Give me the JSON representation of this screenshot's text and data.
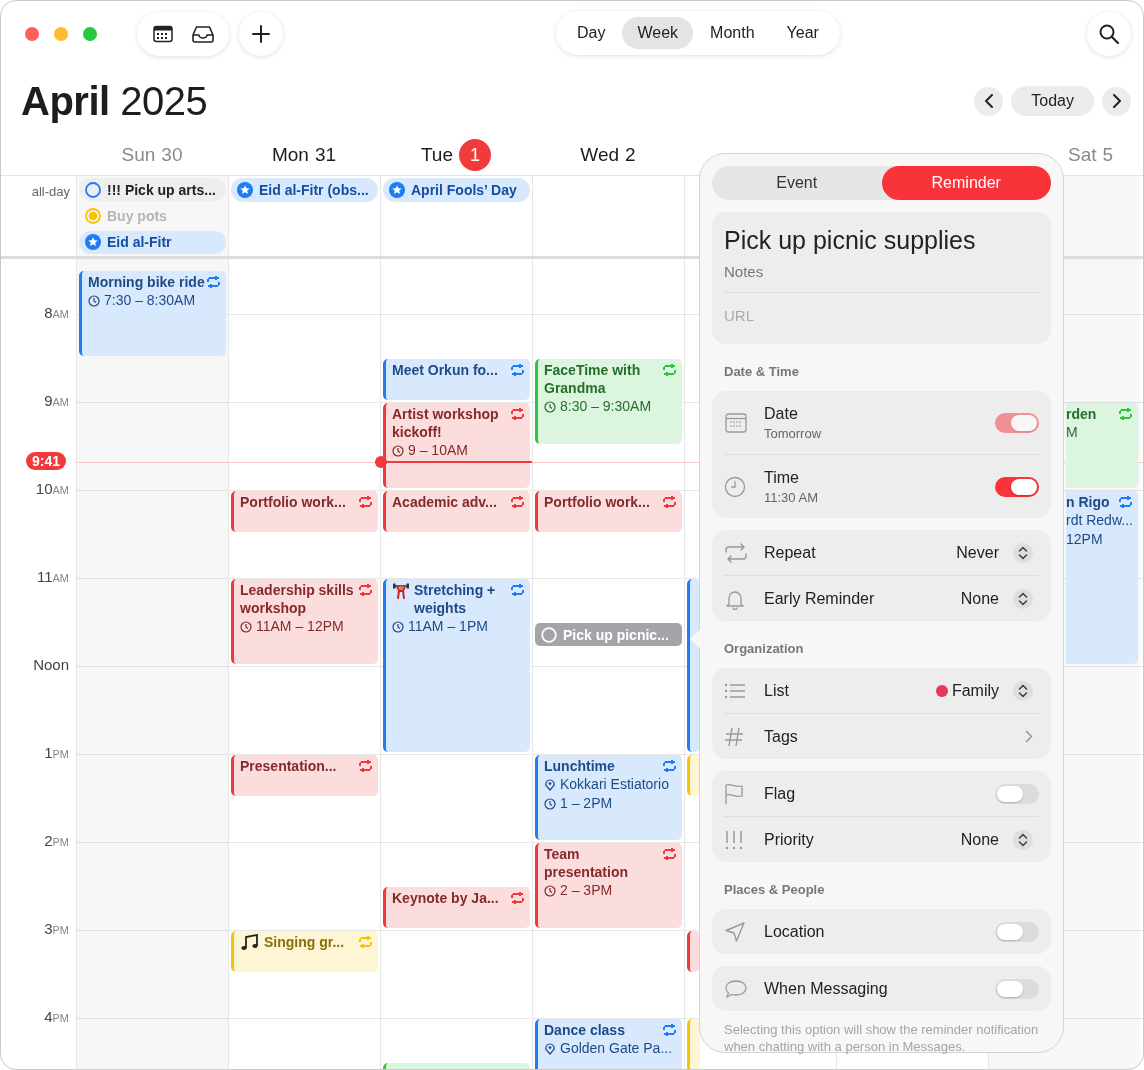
{
  "toolbar": {
    "views": [
      {
        "label": "Day",
        "selected": false
      },
      {
        "label": "Week",
        "selected": true
      },
      {
        "label": "Month",
        "selected": false
      },
      {
        "label": "Year",
        "selected": false
      }
    ],
    "today": "Today"
  },
  "title": {
    "month": "April",
    "year": "2025"
  },
  "all_day_label": "all-day",
  "now": {
    "label": "9:41"
  },
  "hours": [
    {
      "hour": "8",
      "period": "AM"
    },
    {
      "hour": "9",
      "period": "AM"
    },
    {
      "hour": "10",
      "period": "AM"
    },
    {
      "hour": "11",
      "period": "AM"
    },
    {
      "hour": "Noon"
    },
    {
      "hour": "1",
      "period": "PM"
    },
    {
      "hour": "2",
      "period": "PM"
    },
    {
      "hour": "3",
      "period": "PM"
    },
    {
      "hour": "4",
      "period": "PM"
    }
  ],
  "days": [
    {
      "name": "Sun",
      "date": "30",
      "today": false,
      "weekend": true,
      "all_day": [
        {
          "title": "!!! Pick up arts...",
          "kind": "reminder",
          "color": "#1f7cf5",
          "completed": false
        },
        {
          "title": "Buy pots",
          "kind": "reminder",
          "color": "#f5c400",
          "completed": true
        },
        {
          "title": "Eid al-Fitr",
          "kind": "holiday",
          "color": "#1f7cf5"
        }
      ],
      "events": [
        {
          "title": "Morning bike ride",
          "kind": "event",
          "color": "#1f7cf5",
          "repeat": true,
          "time": "7:30 – 8:30AM"
        }
      ]
    },
    {
      "name": "Mon",
      "date": "31",
      "today": false,
      "weekend": false,
      "all_day": [
        {
          "title": "Eid al-Fitr (obs...",
          "kind": "holiday",
          "color": "#1f7cf5"
        }
      ],
      "events": [
        {
          "title": "Portfolio work...",
          "kind": "event",
          "color": "#f0393a",
          "repeat": true
        },
        {
          "title": "Leadership skills workshop",
          "kind": "event",
          "color": "#f0393a",
          "repeat": true,
          "time": "11AM – 12PM"
        },
        {
          "title": "Presentation...",
          "kind": "event",
          "color": "#f0393a",
          "repeat": true
        },
        {
          "title": "Singing gr...",
          "kind": "music",
          "color": "#f5c400",
          "repeat": true
        }
      ]
    },
    {
      "name": "Tue",
      "date": "1",
      "today": true,
      "weekend": false,
      "all_day": [
        {
          "title": "April Fools’ Day",
          "kind": "holiday",
          "color": "#1f7cf5"
        }
      ],
      "events": [
        {
          "title": "Meet Orkun fo...",
          "kind": "event",
          "color": "#1f7cf5",
          "repeat": true
        },
        {
          "title": "Artist workshop kickoff!",
          "kind": "event",
          "color": "#f0393a",
          "repeat": true,
          "time": "9 – 10AM"
        },
        {
          "title": "Academic adv...",
          "kind": "event",
          "color": "#f0393a",
          "repeat": true
        },
        {
          "title": "Stretching + weights",
          "kind": "workout",
          "color": "#1f7cf5",
          "repeat": true,
          "time": "11AM – 1PM"
        },
        {
          "title": "Keynote by Ja...",
          "kind": "event",
          "color": "#f0393a",
          "repeat": true
        },
        {
          "kind": "event",
          "color": "#2fc33f"
        }
      ]
    },
    {
      "name": "Wed",
      "date": "2",
      "today": false,
      "weekend": false,
      "events": [
        {
          "title": "FaceTime with Grandma",
          "kind": "event",
          "color": "#2fc33f",
          "repeat": true,
          "time": "8:30 – 9:30AM"
        },
        {
          "title": "Portfolio work...",
          "kind": "event",
          "color": "#f0393a",
          "repeat": true
        },
        {
          "title": "Pick up picnic...",
          "kind": "reminder",
          "selected": true
        },
        {
          "title": "Lunchtime",
          "kind": "event",
          "color": "#1f7cf5",
          "repeat": true,
          "location": "Kokkari Estiatorio",
          "time": "1 – 2PM"
        },
        {
          "title": "Team presentation",
          "kind": "event",
          "color": "#f0393a",
          "repeat": true,
          "time": "2 – 3PM"
        },
        {
          "title": "Dance class",
          "kind": "event",
          "color": "#1f7cf5",
          "repeat": true,
          "location": "Golden Gate Pa..."
        }
      ]
    },
    {
      "events": [
        {
          "kind": "event",
          "color": "#1f7cf5"
        },
        {
          "kind": "event",
          "color": "#f5c400"
        },
        {
          "kind": "event",
          "color": "#f0393a"
        },
        {
          "kind": "event",
          "color": "#f5c400"
        }
      ]
    },
    {
      "name": "Sat",
      "date": "5",
      "today": false,
      "weekend": true,
      "events": [
        {
          "title": "rden",
          "kind": "event",
          "color": "#2fc33f",
          "repeat": true,
          "time": "M"
        },
        {
          "title": "n Rigo",
          "kind": "event",
          "color": "#1f7cf5",
          "repeat": true,
          "location": "rdt Redw...",
          "time": "12PM"
        }
      ]
    }
  ],
  "popover": {
    "tabs": [
      {
        "label": "Event",
        "selected": false
      },
      {
        "label": "Reminder",
        "selected": true
      }
    ],
    "title": "Pick up picnic supplies",
    "notes": {
      "placeholder": "Notes"
    },
    "url": {
      "placeholder": "URL"
    },
    "sections": [
      {
        "heading": "Date & Time",
        "groups": [
          {
            "rows": [
              {
                "label": "Date",
                "sub": "Tomorrow",
                "kind": "toggle",
                "on": true,
                "disabled": true
              },
              {
                "label": "Time",
                "sub": "11:30 AM",
                "kind": "toggle",
                "on": true,
                "disabled": false
              }
            ]
          },
          {
            "rows": [
              {
                "label": "Repeat",
                "kind": "select",
                "value": "Never"
              },
              {
                "label": "Early Reminder",
                "kind": "select",
                "value": "None"
              }
            ]
          }
        ]
      },
      {
        "heading": "Organization",
        "groups": [
          {
            "rows": [
              {
                "label": "List",
                "kind": "select",
                "value": "Family",
                "color": "#e6375c"
              },
              {
                "label": "Tags",
                "kind": "link"
              }
            ]
          },
          {
            "rows": [
              {
                "label": "Flag",
                "kind": "toggle",
                "on": false,
                "disabled": false
              },
              {
                "label": "Priority",
                "kind": "select",
                "value": "None"
              }
            ]
          }
        ]
      },
      {
        "heading": "Places & People",
        "groups": [
          {
            "rows": [
              {
                "label": "Location",
                "kind": "toggle",
                "on": false,
                "disabled": false
              }
            ]
          },
          {
            "rows": [
              {
                "label": "When Messaging",
                "kind": "toggle",
                "on": false,
                "disabled": false
              }
            ]
          }
        ],
        "note": "Selecting this option will show the reminder notification when chatting with a person in Messages."
      }
    ]
  }
}
